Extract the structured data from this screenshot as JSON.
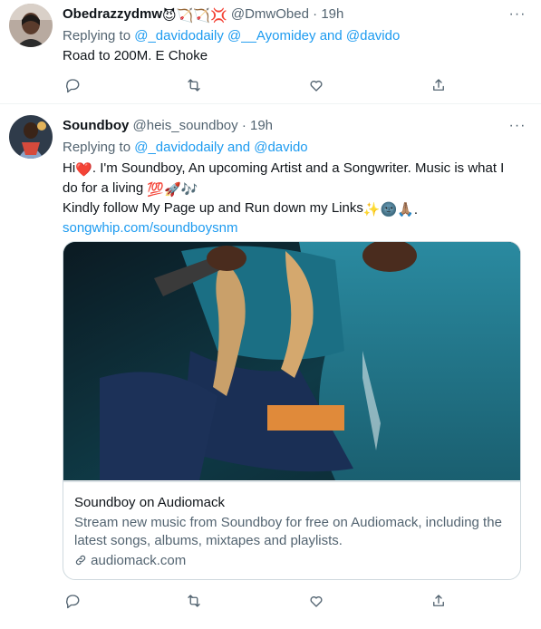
{
  "tweets": [
    {
      "display_name": "Obedrazzydmw",
      "name_emojis": "😈🏹🏹💢",
      "handle": "@DmwObed",
      "separator": "·",
      "time": "19h",
      "replying_prefix": "Replying to",
      "replying_mentions": [
        "@_davidodaily",
        "@__Ayomidey",
        "and",
        "@davido"
      ],
      "text": "Road to 200M. E Choke"
    },
    {
      "display_name": "Soundboy",
      "handle": "@heis_soundboy",
      "separator": "·",
      "time": "19h",
      "replying_prefix": "Replying to",
      "replying_mentions": [
        "@_davidodaily",
        "and",
        "@davido"
      ],
      "text_line1_a": "Hi",
      "text_line1_heart": "❤️",
      "text_line1_b": ". I'm Soundboy, An upcoming Artist and a Songwriter. Music is what I",
      "text_line2": "do for a living",
      "text_line2_emojis": "💯🚀🎶",
      "text_line3": "Kindly follow My Page up and Run down my Links",
      "text_line3_emojis": "✨🌚🙏🏽.",
      "link": "songwhip.com/soundboysnm",
      "card": {
        "title": "Soundboy on Audiomack",
        "description": "Stream new music from Soundboy for free on Audiomack, including the latest songs, albums, mixtapes and playlists.",
        "domain": "audiomack.com"
      }
    }
  ],
  "more_icon": "···",
  "icons": [
    "reply-icon",
    "retweet-icon",
    "like-icon",
    "share-icon",
    "more-icon",
    "link-icon"
  ],
  "colors": {
    "accent": "#1d9bf0",
    "secondary_text": "#536471",
    "border": "#cfd9de"
  }
}
